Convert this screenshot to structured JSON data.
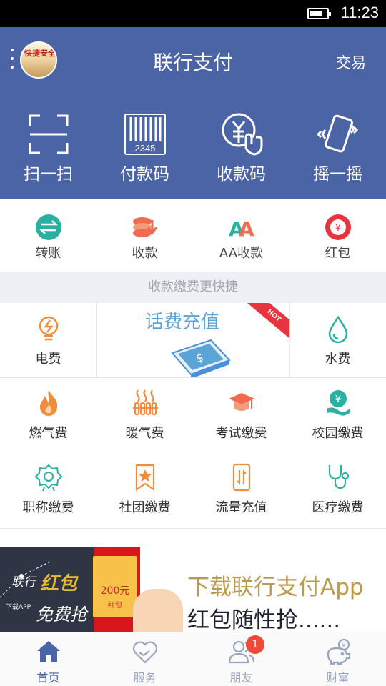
{
  "status_bar": {
    "time": "11:23",
    "battery_level_pct": 60
  },
  "header": {
    "title": "联行支付",
    "right_action": "交易",
    "avatar_caption": "快捷安全"
  },
  "quick_actions": [
    {
      "label": "扫一扫",
      "icon": "scan-icon"
    },
    {
      "label": "付款码",
      "icon": "barcode-icon",
      "code_text": "2345"
    },
    {
      "label": "收款码",
      "icon": "yuan-tap-icon"
    },
    {
      "label": "摇一摇",
      "icon": "shake-phone-icon"
    }
  ],
  "functions": [
    {
      "label": "转账",
      "icon": "transfer-icon"
    },
    {
      "label": "收款",
      "icon": "receive-money-icon"
    },
    {
      "label": "AA收款",
      "icon": "aa-icon"
    },
    {
      "label": "红包",
      "icon": "red-packet-icon"
    }
  ],
  "section_banner": "收款缴费更快捷",
  "promo": {
    "title": "话费充值",
    "tag": "HOT"
  },
  "services": [
    {
      "label": "电费",
      "icon": "electricity-icon"
    },
    {
      "label": "水费",
      "icon": "water-drop-icon"
    },
    {
      "label": "燃气费",
      "icon": "flame-icon"
    },
    {
      "label": "暖气费",
      "icon": "heater-icon"
    },
    {
      "label": "考试缴费",
      "icon": "graduation-cap-icon"
    },
    {
      "label": "校园缴费",
      "icon": "campus-yuan-icon"
    },
    {
      "label": "职称缴费",
      "icon": "badge-medal-icon"
    },
    {
      "label": "社团缴费",
      "icon": "star-bookmark-icon"
    },
    {
      "label": "流量充值",
      "icon": "data-phone-icon"
    },
    {
      "label": "医疗缴费",
      "icon": "stethoscope-icon"
    }
  ],
  "banner": {
    "left_prefix": "联行",
    "left_highlight": "红包",
    "left_line2": "免费抢",
    "left_small": "下载APP",
    "envelope_amount": "200元",
    "envelope_label": "红包",
    "title": "下载联行支付App",
    "subtitle": "红包随性抢......"
  },
  "tabbar": [
    {
      "label": "首页",
      "icon": "home-icon",
      "active": true
    },
    {
      "label": "服务",
      "icon": "heart-icon",
      "active": false
    },
    {
      "label": "朋友",
      "icon": "friends-icon",
      "active": false,
      "badge": "1"
    },
    {
      "label": "财富",
      "icon": "piggy-bank-icon",
      "active": false
    }
  ],
  "colors": {
    "brand": "#4b64a6",
    "accent_orange": "#f08c3c",
    "accent_teal": "#2ab0a0",
    "hot_red": "#e8343f"
  }
}
